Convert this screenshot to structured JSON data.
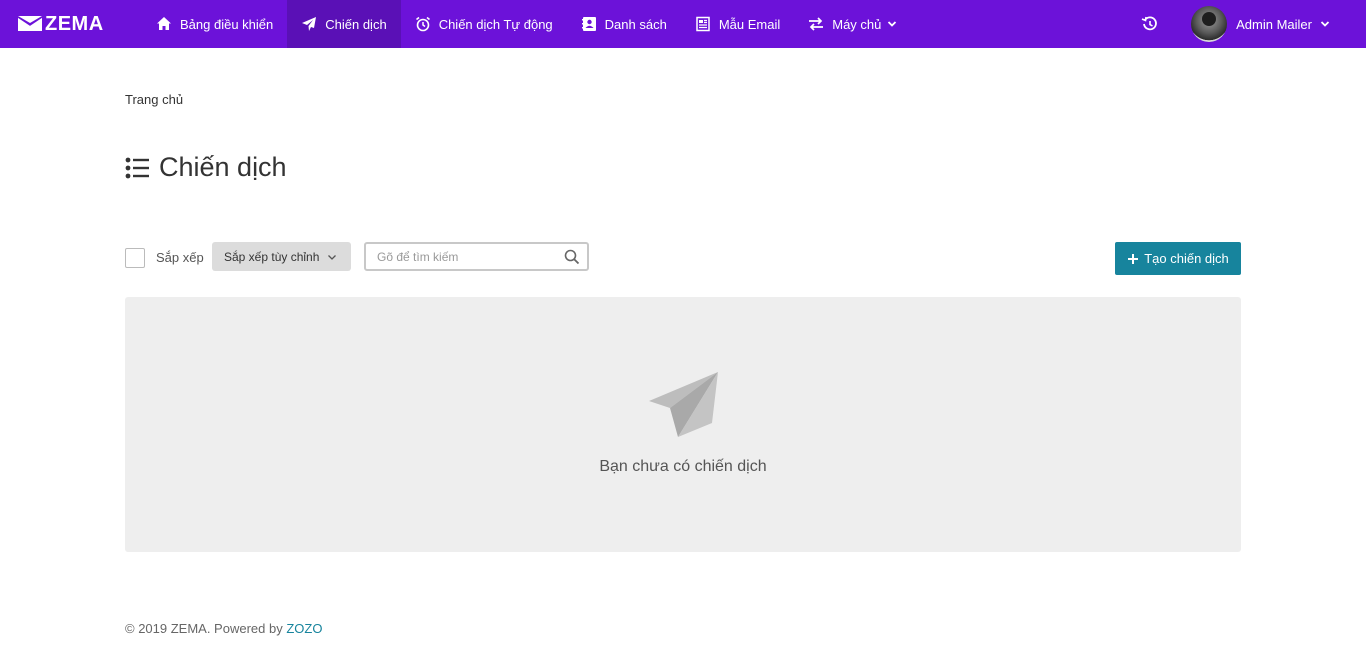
{
  "brand": {
    "name": "ZEMA",
    "color": "#6c12d9"
  },
  "nav": {
    "items": [
      {
        "label": "Bảng điều khiển",
        "icon": "home-icon"
      },
      {
        "label": "Chiến dịch",
        "icon": "paper-plane-icon",
        "active": true
      },
      {
        "label": "Chiến dịch Tự động",
        "icon": "alarm-clock-icon"
      },
      {
        "label": "Danh sách",
        "icon": "contact-book-icon"
      },
      {
        "label": "Mẫu Email",
        "icon": "newspaper-icon"
      },
      {
        "label": "Máy chủ",
        "icon": "exchange-arrows-icon",
        "dropdown": true
      }
    ]
  },
  "user": {
    "name": "Admin Mailer",
    "icon": "history-icon"
  },
  "breadcrumb": {
    "home": "Trang chủ"
  },
  "page": {
    "title": "Chiến dịch",
    "icon": "list-icon"
  },
  "toolbar": {
    "sort_label": "Sắp xếp",
    "sort_select": "Sắp xếp tùy chỉnh",
    "search_placeholder": "Gõ để tìm kiếm",
    "create_label": "Tạo chiến dịch",
    "create_color": "#17849d"
  },
  "empty": {
    "message": "Bạn chưa có chiến dịch",
    "icon": "paper-plane-icon"
  },
  "footer": {
    "copyright": "© 2019 ZEMA. Powered by",
    "link": "ZOZO"
  }
}
